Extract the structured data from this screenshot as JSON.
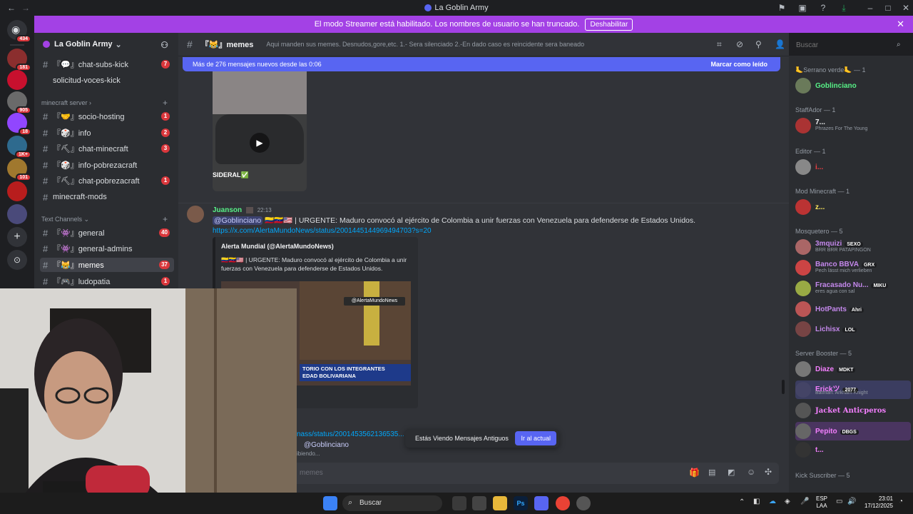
{
  "window": {
    "title": "La Goblin Army"
  },
  "banner": {
    "message": "El modo Streamer está habilitado. Los nombres de usuario se han truncado.",
    "button": "Deshabilitar"
  },
  "rail": {
    "badges": [
      "434",
      "181",
      "905",
      "18",
      "1K+",
      "101"
    ]
  },
  "server": {
    "name": "La Goblin Army"
  },
  "channels": {
    "top": [
      {
        "name": "『💬』chat-subs-kick",
        "badge": "7"
      },
      {
        "name": "solicitud-voces-kick",
        "badge": ""
      }
    ],
    "cat_minecraft": "minecraft server",
    "minecraft": [
      {
        "name": "『🤝』socio-hosting",
        "badge": "1"
      },
      {
        "name": "『🎲』info",
        "badge": "2"
      },
      {
        "name": "『⛏』chat-minecraft",
        "badge": "3"
      },
      {
        "name": "『🎲』info-pobrezacraft",
        "badge": ""
      },
      {
        "name": "『⛏』chat-pobrezacraft",
        "badge": "1"
      },
      {
        "name": "minecraft-mods",
        "badge": ""
      }
    ],
    "cat_text": "Text Channels",
    "text": [
      {
        "name": "『👾』general",
        "badge": "40"
      },
      {
        "name": "『👾』general-admins",
        "badge": ""
      },
      {
        "name": "『😹』memes",
        "badge": "37"
      },
      {
        "name": "『🎮』ludopatia",
        "badge": "1"
      }
    ]
  },
  "header": {
    "channel": "『😹』memes",
    "topic": "Aqui manden sus memes. Desnudos,gore,etc. 1.- Sera silenciado 2.-En dado caso es reincidente sera baneado",
    "search_placeholder": "Buscar"
  },
  "newbar": {
    "text": "Más de 276 mensajes nuevos desde las 0:06",
    "mark": "Marcar como leído"
  },
  "video1": {
    "caption": "SIDERAL✅"
  },
  "message": {
    "author": "Juanson",
    "time": "22:13",
    "mention": "@Goblinciano",
    "text": "🇨🇴🇻🇪🇺🇸 | URGENTE: Maduro convocó al ejército de Colombia a unir fuerzas con Venezuela para defenderse de Estados Unidos.",
    "link": "https://x.com/AlertaMundoNews/status/2001445144969494703?s=20",
    "embed_author": "Alerta Mundial (@AlertaMundoNews)",
    "embed_text": "🇨🇴🇻🇪🇺🇸 | URGENTE: Maduro convocó al ejército de Colombia a unir fuerzas con Venezuela para defenderse de Estados Unidos.",
    "watermark": "@AlertaMundoNews",
    "chyron1": "TORIO CON LOS INTEGRANTES",
    "chyron2": "EDAD BOLIVARIANA"
  },
  "partial": {
    "link": "nass/status/2001453562136535...",
    "mention": "@Goblinciano",
    "writing": "ibiendo..."
  },
  "toast": {
    "text": "Estás Viendo Mensajes Antiguos",
    "button": "Ir al actual"
  },
  "composer": {
    "placeholder": "memes"
  },
  "members": {
    "groups": [
      {
        "title": "🦶Serrano verde🦶 — 1",
        "items": [
          {
            "name": "Goblinciano",
            "status": "",
            "tag": "",
            "color": "#57f287"
          }
        ]
      },
      {
        "title": "StaffAdor — 1",
        "items": [
          {
            "name": "7...",
            "status": "Phrazes For The Young",
            "tag": "",
            "color": "#f2f3f5"
          }
        ]
      },
      {
        "title": "Editor — 1",
        "items": [
          {
            "name": "i...",
            "status": "",
            "tag": "",
            "color": "#f23f43"
          }
        ]
      },
      {
        "title": "Mod Minecraft — 1",
        "items": [
          {
            "name": "z...",
            "status": "",
            "tag": "",
            "color": "#fee75c"
          }
        ]
      },
      {
        "title": "Mosquetero — 5",
        "items": [
          {
            "name": "3mquizi",
            "status": "BRR BRR PATAPINGON",
            "tag": "SEXO",
            "color": "#c488ec"
          },
          {
            "name": "Banco BBVA",
            "status": "Pech lässt mich verlieben",
            "tag": "GRX",
            "color": "#c488ec"
          },
          {
            "name": "Fracasado Nu...",
            "status": "eres agua con sal",
            "tag": "MIKU",
            "color": "#c488ec"
          },
          {
            "name": "HotPants",
            "status": "",
            "tag": "Ahri",
            "color": "#c488ec"
          },
          {
            "name": "Lichisx",
            "status": "",
            "tag": "LOL",
            "color": "#c488ec"
          }
        ]
      },
      {
        "title": "Server Booster — 5",
        "items": [
          {
            "name": "Diaze",
            "status": "",
            "tag": "MDKT",
            "color": "#f47fff"
          },
          {
            "name": "Erickツ",
            "status": "Batman: Arkham Knight",
            "tag": "2077",
            "color": "#f47fff"
          },
          {
            "name": "Jacket Anticperos",
            "status": "",
            "tag": "",
            "color": "#f47fff"
          },
          {
            "name": "Pepito",
            "status": "",
            "tag": "DBGS",
            "color": "#f47fff"
          },
          {
            "name": "t...",
            "status": "",
            "tag": "",
            "color": "#f47fff"
          }
        ]
      },
      {
        "title": "Kick Suscriber — 5",
        "items": []
      }
    ]
  },
  "taskbar": {
    "search": "Buscar",
    "lang1": "ESP",
    "lang2": "LAA",
    "time": "23:01",
    "date": "17/12/2025"
  },
  "colors": {
    "accent": "#5865f2",
    "banner": "#a341e5",
    "badge": "#da373c"
  }
}
